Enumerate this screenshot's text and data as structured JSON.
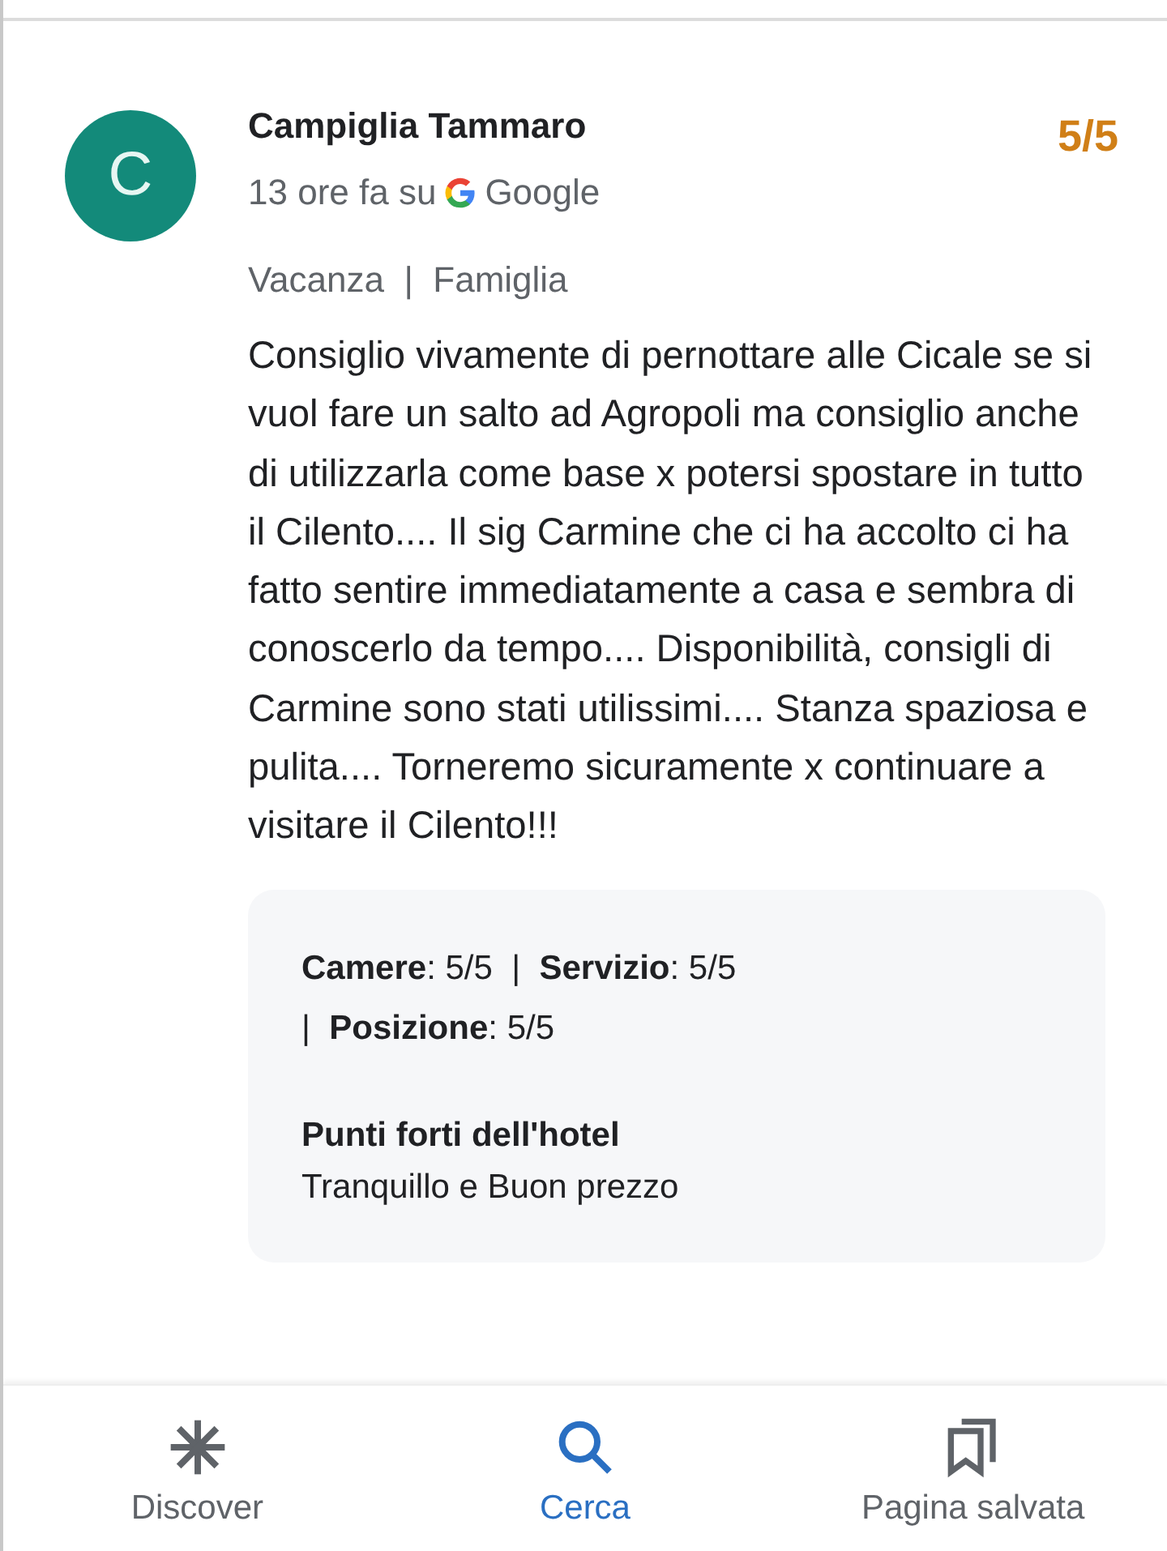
{
  "review": {
    "avatar_letter": "C",
    "author": "Campiglia Tammaro",
    "time": "13 ore fa su",
    "source": "Google",
    "rating": "5/5",
    "tags": "Vacanza  |  Famiglia",
    "text": "Consiglio vivamente di pernottare alle Cicale se si vuol fare un salto ad Agropoli ma consiglio anche di utilizzarla come base x potersi spostare in tutto il Cilento.... Il sig Carmine che ci ha accolto ci ha fatto sentire immediatamente a casa e sembra di conoscerlo da tempo.... Disponibilità, consigli di Carmine sono stati utilissimi.... Stanza spaziosa e pulita.... Torneremo sicuramente x continuare a visitare il Cilento!!!",
    "details": {
      "ratings": "**Camere**: 5/5  |  **Servizio**: 5/5  |  **Posizione**: 5/5",
      "highlights_title": "Punti forti dell'hotel",
      "highlights": "Tranquillo e Buon prezzo"
    }
  },
  "nav": [
    {
      "label": "Discover",
      "kind": "asterisk",
      "selected": false
    },
    {
      "label": "Cerca",
      "kind": "search",
      "selected": true
    },
    {
      "label": "Pagina salvata",
      "kind": "bookmarks",
      "selected": false
    }
  ]
}
